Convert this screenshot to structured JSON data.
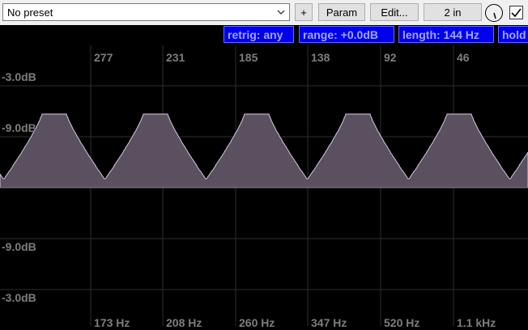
{
  "toolbar": {
    "preset_value": "No preset",
    "add_label": "+",
    "param_label": "Param",
    "edit_label": "Edit...",
    "io_label": "2 in",
    "bypass_checked": true
  },
  "status": {
    "retrig": "retrig: any",
    "range": "range: +0.0dB",
    "length": "length: 144 Hz",
    "hold": "hold"
  },
  "colors": {
    "background": "#000000",
    "waveform_fill": "#5a5060",
    "waveform_edge": "#d8c8e0",
    "status_bg": "#0000ee",
    "status_text": "#a6a6ff",
    "grid": "#2e2e2e",
    "axis_text": "#7d7d7d"
  },
  "graph": {
    "top_ticks": [
      "277",
      "231",
      "185",
      "138",
      "92",
      "46"
    ],
    "bottom_ticks": [
      "173 Hz",
      "208 Hz",
      "260 Hz",
      "347 Hz",
      "520 Hz",
      "1.1 kHz"
    ],
    "db_labels": [
      "-3.0dB",
      "-9.0dB",
      "-9.0dB",
      "-3.0dB"
    ],
    "waveform": {
      "cycles": 5,
      "peak_level": -9.0,
      "trough_level": -12.0
    }
  }
}
